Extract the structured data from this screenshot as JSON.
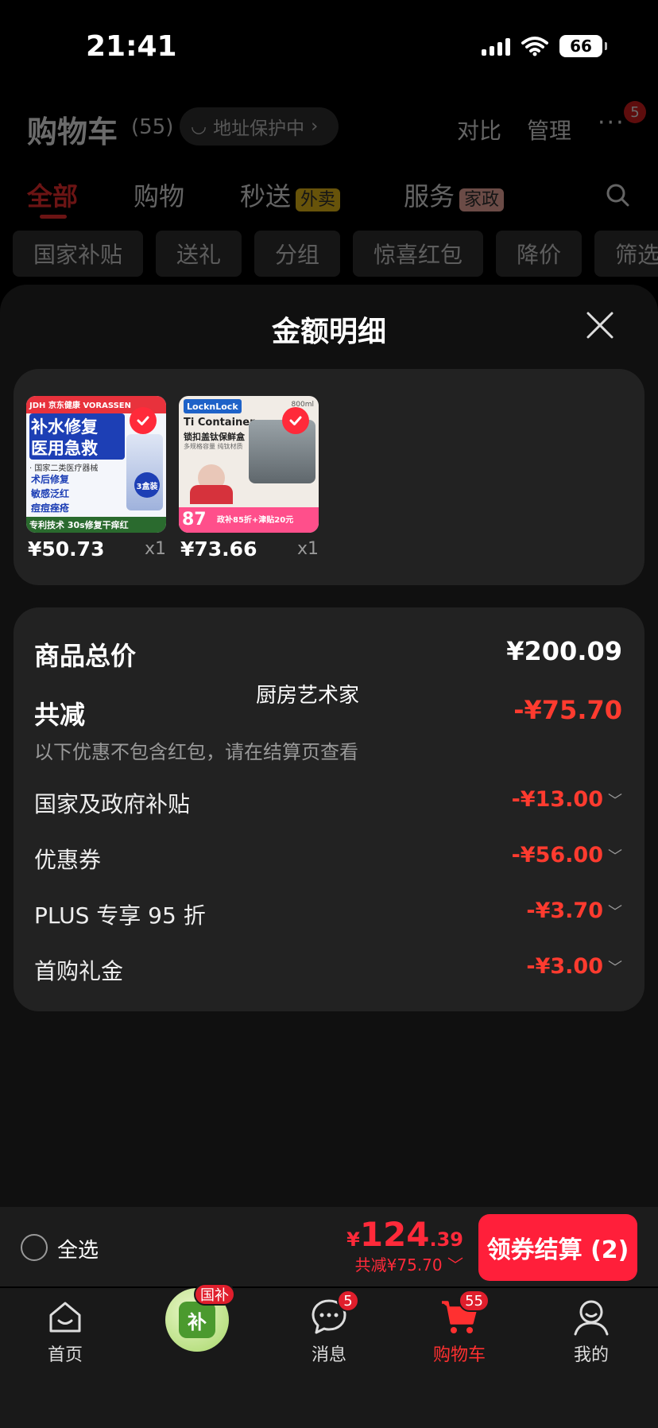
{
  "status_bar": {
    "time": "21:41",
    "battery": "66"
  },
  "cart_header": {
    "title": "购物车",
    "count": "(55)",
    "address_pill": "地址保护中",
    "compare": "对比",
    "manage": "管理",
    "more_badge": "5"
  },
  "category_tabs": [
    {
      "label": "全部"
    },
    {
      "label": "购物"
    },
    {
      "label": "秒送",
      "tag": "外卖"
    },
    {
      "label": "服务",
      "tag": "家政"
    }
  ],
  "filter_chips": [
    "国家补贴",
    "送礼",
    "分组",
    "惊喜红包",
    "降价",
    "筛选"
  ],
  "sheet": {
    "title": "金额明细",
    "products": [
      {
        "price": "¥50.73",
        "qty": "x1",
        "img_lines": [
          "JDH 京东健康  VORASSEN",
          "补水修复",
          "医用急救",
          "· 国家二类医疗器械",
          "术后修复",
          "敏感泛红",
          "痘痘痤疮",
          "专利技术 30s修复干痒红",
          "3盒装"
        ]
      },
      {
        "price": "¥73.66",
        "qty": "x1",
        "img_lines": [
          "LocknLock",
          "Ti Container",
          "锁扣盖钛保鲜盒",
          "多规格容量 纯钛材质",
          "87",
          "政补85折+津贴20元",
          "800ml"
        ]
      }
    ],
    "breakdown": {
      "total_label": "商品总价",
      "total_value": "¥200.09",
      "shop_name": "厨房艺术家",
      "discount_label": "共减",
      "discount_value": "-¥75.70",
      "note": "以下优惠不包含红包，请在结算页查看",
      "items": [
        {
          "label": "国家及政府补贴",
          "value": "-¥13.00"
        },
        {
          "label": "优惠券",
          "value": "-¥56.00"
        },
        {
          "label": "PLUS 专享 95 折",
          "value": "-¥3.70"
        },
        {
          "label": "首购礼金",
          "value": "-¥3.00"
        }
      ]
    }
  },
  "checkout": {
    "select_all": "全选",
    "yen": "¥",
    "total_int": "124",
    "total_dec": ".39",
    "saved": "共减¥75.70",
    "button": "领券结算 (2)"
  },
  "tab_bar": {
    "home": "首页",
    "subsidy_badge": "国补",
    "subsidy_icon_text": "补",
    "messages": "消息",
    "messages_badge": "5",
    "cart": "购物车",
    "cart_badge": "55",
    "me": "我的"
  },
  "colors": {
    "accent": "#ff1f3a",
    "discount": "#ff3b2f",
    "sheet_bg": "#101010",
    "card_bg": "#222222"
  }
}
